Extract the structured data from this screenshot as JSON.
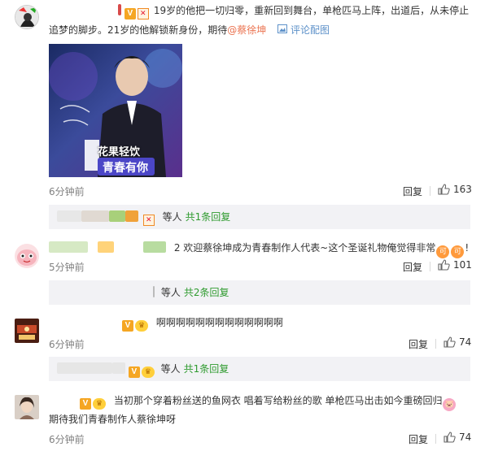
{
  "comments": [
    {
      "text_line1": "19岁的他把一切归零，重新回到舞台，单枪匹马上阵，出道后，从未停止",
      "text_line2": "追梦的脚步。21岁的他解锁新身份，期待",
      "mention": "@蔡徐坤",
      "pic_link": "评论配图",
      "photo_caption": "青春有你",
      "photo_brand": "花果轻饮",
      "time": "6分钟前",
      "reply_label": "回复",
      "likes": "163",
      "sub_text": "等人",
      "sub_more": "共1条回复"
    },
    {
      "text": "2 欢迎蔡徐坤成为青春制作人代表~这个圣诞礼物俺觉得非常",
      "text_end": "!",
      "emoji_label": "可",
      "time": "5分钟前",
      "reply_label": "回复",
      "likes": "101",
      "sub_text": "等人",
      "sub_more": "共2条回复"
    },
    {
      "text": "啊啊啊啊啊啊啊啊啊啊啊啊啊",
      "time": "6分钟前",
      "reply_label": "回复",
      "likes": "74",
      "sub_text": "等人",
      "sub_more": "共1条回复"
    },
    {
      "text_line1": "当初那个穿着粉丝送的鱼网衣 唱着写给粉丝的歌 单枪匹马出击如今重磅回归",
      "text_line2": "期待我们青春制作人蔡徐坤呀",
      "time": "6分钟前",
      "reply_label": "回复",
      "likes": "74"
    }
  ],
  "badge_v": "V",
  "colors": {
    "mention": "#eb7350",
    "reply_more": "#2f9b2f",
    "pic_link": "#5d91c9",
    "sub_bg": "#f2f2f5",
    "time": "#808080"
  }
}
